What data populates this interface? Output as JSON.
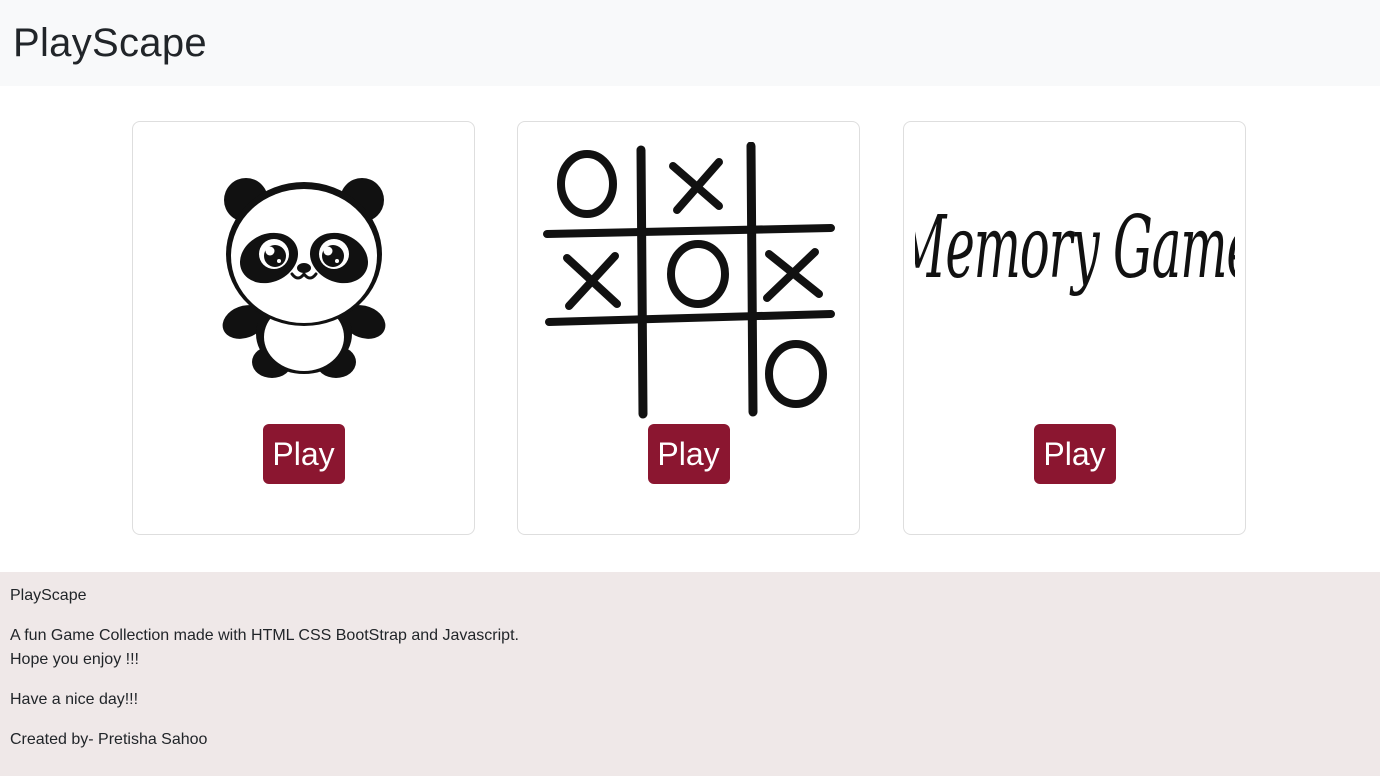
{
  "navbar": {
    "brand": "PlayScape"
  },
  "cards": [
    {
      "name": "panda-game",
      "image_icon": "panda-icon",
      "button_label": "Play"
    },
    {
      "name": "tic-tac-toe",
      "image_icon": "tic-tac-toe-board-icon",
      "button_label": "Play"
    },
    {
      "name": "memory-game",
      "image_icon": "memory-game-logo",
      "image_text": "Memory Game",
      "button_label": "Play"
    }
  ],
  "footer": {
    "title": "PlayScape",
    "line1": "A fun Game Collection made with HTML CSS BootStrap and Javascript.",
    "line2": "Hope you enjoy !!!",
    "line3": "Have a nice day!!!",
    "credit": "Created by- Pretisha Sahoo"
  },
  "colors": {
    "accent": "#8b1630",
    "navbar_bg": "#f8f9fa",
    "footer_bg": "#efe8e8"
  }
}
